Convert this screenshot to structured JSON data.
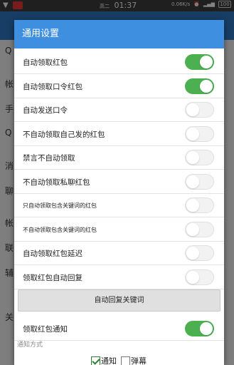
{
  "status_bar": {
    "carrier": "高二",
    "time": "01:37",
    "net_speed": "0.06K/s",
    "battery": "100"
  },
  "background": {
    "labels": [
      "Q",
      "帐",
      "手",
      "Q",
      "消",
      "聊",
      "帐",
      "联",
      "辅",
      "关"
    ]
  },
  "dialog": {
    "title": "通用设置",
    "settings": [
      {
        "label": "自动领取红包",
        "on": true,
        "small": false
      },
      {
        "label": "自动领取口令红包",
        "on": true,
        "small": false
      },
      {
        "label": "自动发送口令",
        "on": false,
        "small": false
      },
      {
        "label": "不自动领取自己发的红包",
        "on": false,
        "small": false
      },
      {
        "label": "禁言不自动领取",
        "on": false,
        "small": false
      },
      {
        "label": "不自动领取私聊红包",
        "on": false,
        "small": false
      },
      {
        "label": "只自动领取包含关键词的红包",
        "on": false,
        "small": true
      },
      {
        "label": "不自动领取包含关键词的红包",
        "on": false,
        "small": true
      },
      {
        "label": "自动领取红包延迟",
        "on": false,
        "small": false
      },
      {
        "label": "领取红包自动回复",
        "on": false,
        "small": false
      }
    ],
    "auto_reply_keywords_button": "自动回复关键词",
    "notify_setting": {
      "label": "领取红包通知",
      "on": true
    },
    "notify_method": {
      "title": "通知方式",
      "options": [
        {
          "label": "通知",
          "checked": true
        },
        {
          "label": "弹幕",
          "checked": false
        }
      ]
    }
  }
}
